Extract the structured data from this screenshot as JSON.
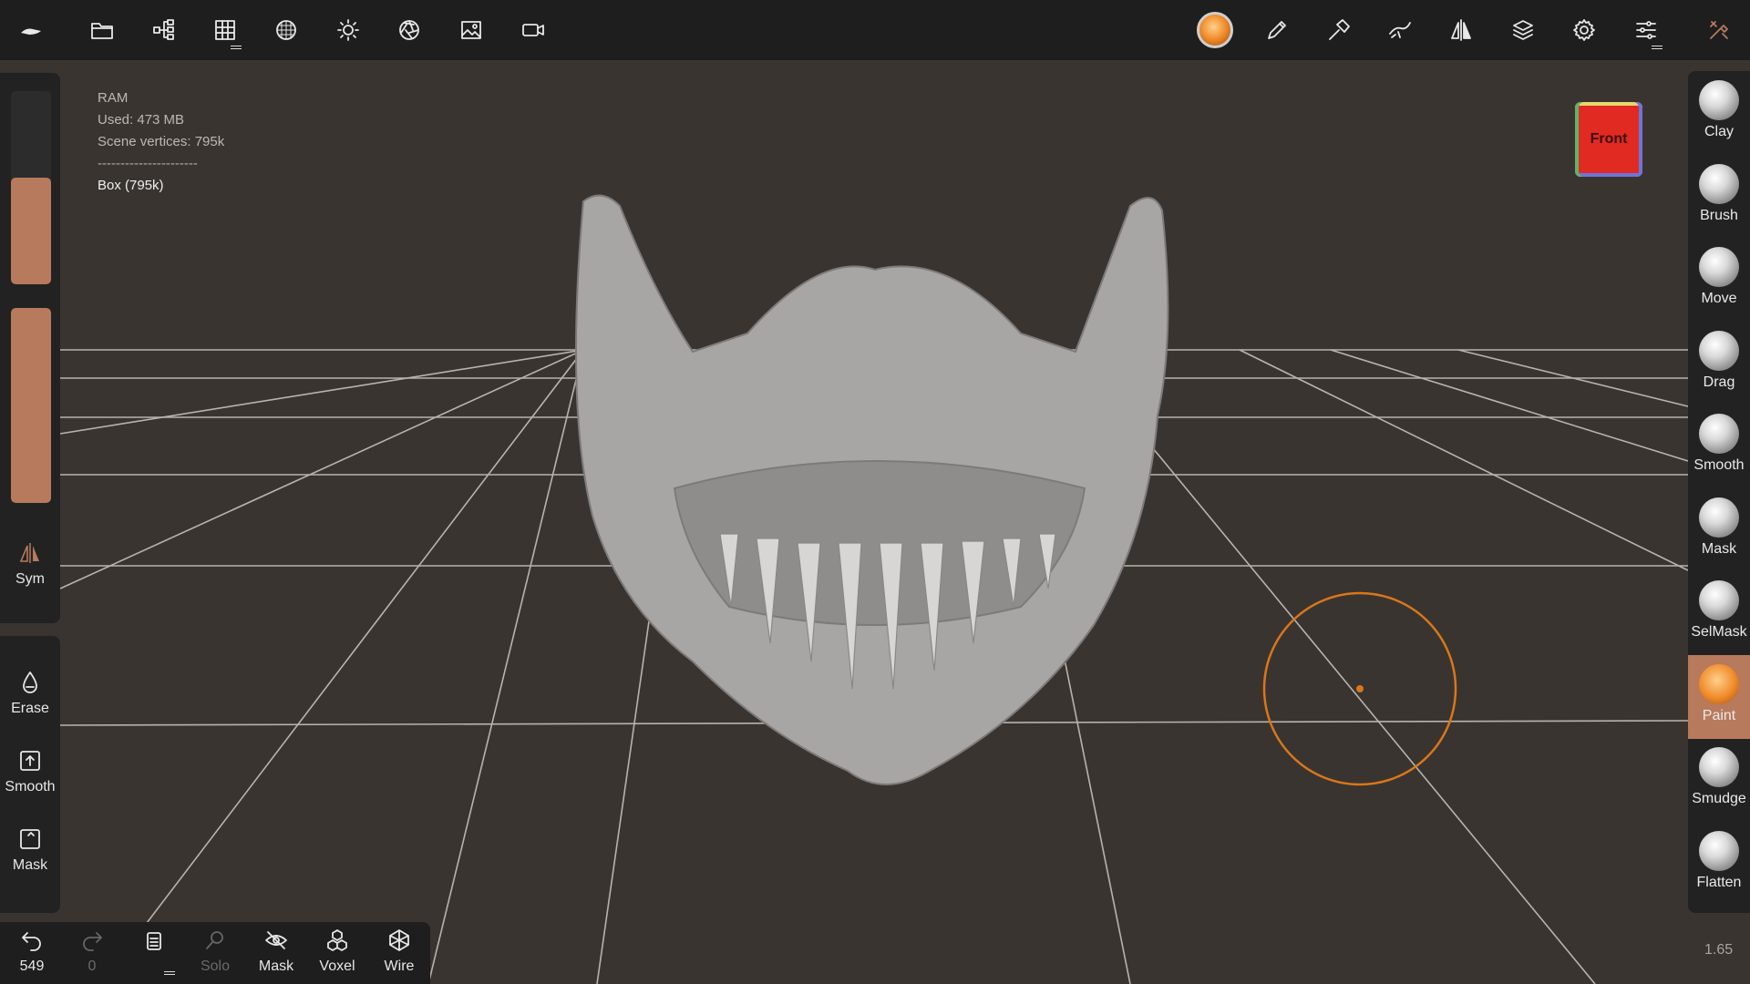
{
  "topbar": {
    "left_icons": [
      "app-logo-icon",
      "folder-icon",
      "scene-tree-icon",
      "grid-icon",
      "material-sphere-icon",
      "light-icon",
      "aperture-icon",
      "image-icon",
      "camera-icon"
    ],
    "right_icons": [
      "brush-color-icon",
      "pen-icon",
      "hammer-icon",
      "stroke-icon",
      "symmetry-icon",
      "layers-icon",
      "settings-icon",
      "sliders-icon",
      "tools-icon"
    ]
  },
  "info": {
    "ram_label": "RAM",
    "used": "Used: 473 MB",
    "scene_vertices": "Scene vertices: 795k",
    "separator": "----------------------",
    "mesh": "Box (795k)"
  },
  "left_panel": {
    "radius_slider_level": 0.55,
    "intensity_slider_level": 1.0,
    "sym_label": "Sym",
    "erase_label": "Erase",
    "smooth_label": "Smooth",
    "mask_label": "Mask"
  },
  "bottombar": {
    "undo_count": "549",
    "redo_count": "0",
    "solo_label": "Solo",
    "mask_label": "Mask",
    "voxel_label": "Voxel",
    "wire_label": "Wire"
  },
  "tools": [
    {
      "label": "Clay",
      "active": false
    },
    {
      "label": "Brush",
      "active": false
    },
    {
      "label": "Move",
      "active": false
    },
    {
      "label": "Drag",
      "active": false
    },
    {
      "label": "Smooth",
      "active": false
    },
    {
      "label": "Mask",
      "active": false
    },
    {
      "label": "SelMask",
      "active": false
    },
    {
      "label": "Paint",
      "active": true
    },
    {
      "label": "Smudge",
      "active": false
    },
    {
      "label": "Flatten",
      "active": false
    }
  ],
  "viewcube": {
    "label": "Front"
  },
  "zoom": "1.65",
  "colors": {
    "accent": "#b87a5c",
    "cursor_ring": "#d9771a",
    "background": "#3a3430"
  }
}
